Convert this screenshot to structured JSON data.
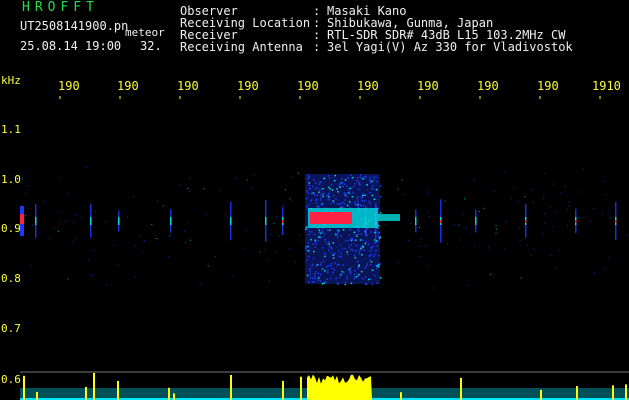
{
  "header": {
    "logo_text": "HROFFT",
    "file_name": "UT2508141900.pn",
    "file_suffix": "meteor",
    "date_time": "25.08.14 19:00",
    "count": "32."
  },
  "info": [
    {
      "label": "Observer",
      "colon": ":",
      "value": "Masaki Kano"
    },
    {
      "label": "Receiving Location",
      "colon": ":",
      "value": "Shibukawa, Gunma, Japan"
    },
    {
      "label": "Receiver",
      "colon": ":",
      "value": "RTL-SDR SDR# 43dB L15 103.2MHz CW"
    },
    {
      "label": "Receiving Antenna",
      "colon": ":",
      "value": "3el Yagi(V) Az 330 for Vladivostok"
    }
  ],
  "axis": {
    "unit_label": "kHz",
    "time_ticks": [
      "190",
      "190",
      "190",
      "190",
      "190",
      "190",
      "190",
      "190",
      "190",
      "1910"
    ],
    "freq_ticks": [
      "1.1",
      "1.0",
      "0.9",
      "0.8",
      "0.7",
      "0.6"
    ]
  },
  "colors": {
    "labels": "#ffff33",
    "title": "#22dd44",
    "info": "#f0f0f0",
    "background": "#000000",
    "signal_low": "#1a3aff",
    "signal_mid": "#00dddd",
    "signal_high": "#ff2244",
    "activity_bar": "#ffff00",
    "activity_base": "#00e5ff"
  }
}
